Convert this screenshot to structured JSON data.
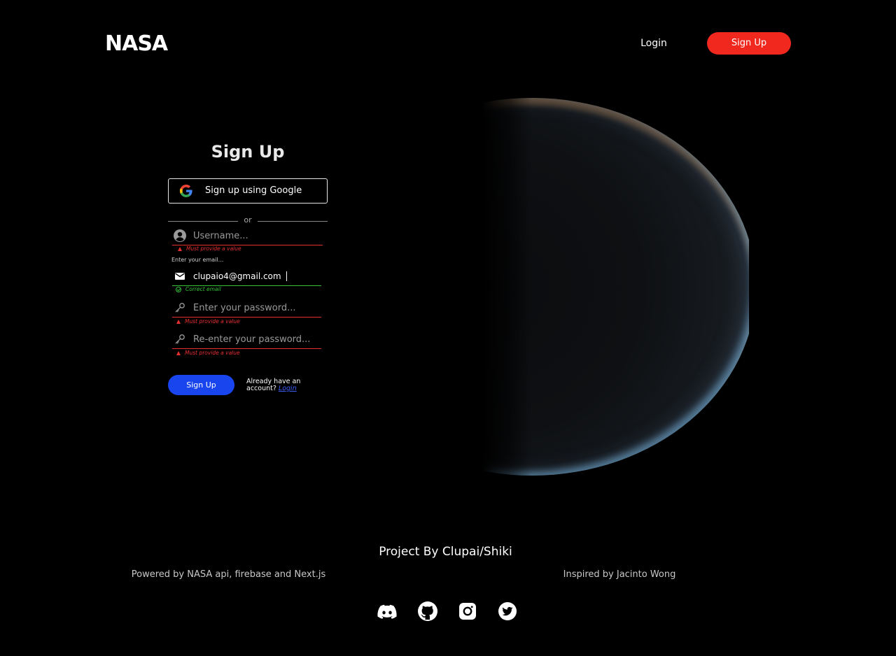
{
  "header": {
    "logo_text": "NASA",
    "login_label": "Login",
    "signup_label": "Sign Up"
  },
  "form": {
    "title": "Sign Up",
    "google_label": "Sign up using Google",
    "or_label": "or",
    "username": {
      "placeholder": "Username...",
      "value": "",
      "error": "Must provide a value"
    },
    "email": {
      "label": "Enter your email...",
      "value": "clupaio4@gmail.com",
      "success": "Correct email"
    },
    "password": {
      "placeholder": "Enter your password...",
      "value": "",
      "error": "Must provide a value"
    },
    "confirm_password": {
      "placeholder": "Re-enter your password...",
      "value": "",
      "error": "Must provide a value"
    },
    "submit_label": "Sign Up",
    "already_text": "Already have an account?",
    "login_link": "Login"
  },
  "footer": {
    "credit": "Project By Clupai/Shiki",
    "powered_by": "Powered by NASA api, firebase and Next.js",
    "inspired_by": "Inspired by Jacinto Wong",
    "social": [
      "discord-icon",
      "github-icon",
      "instagram-icon",
      "twitter-icon"
    ]
  },
  "colors": {
    "accent_red": "#f0281e",
    "primary_blue": "#1845ee",
    "error_red": "#e53030",
    "success_green": "#35c235",
    "background": "#000000"
  }
}
